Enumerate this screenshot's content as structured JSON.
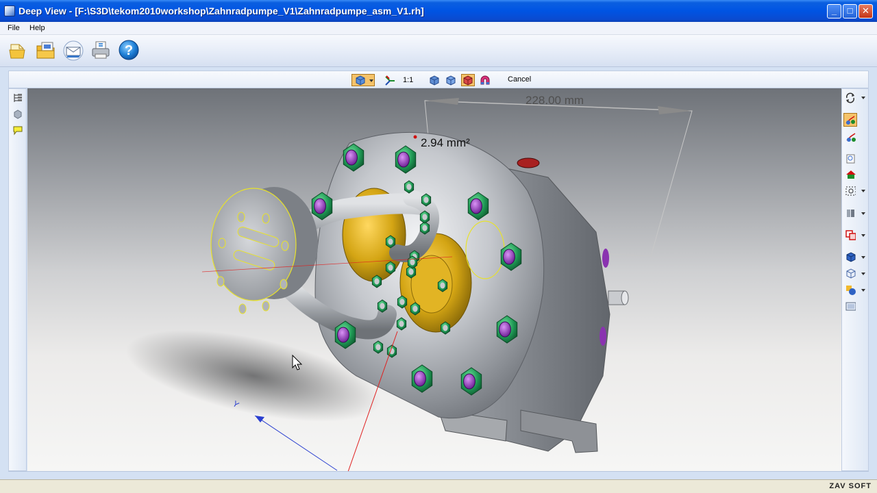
{
  "window": {
    "title": "Deep View - [F:\\S3D\\tekom2010workshop\\Zahnradpumpe_V1\\Zahnradpumpe_asm_V1.rh]",
    "min_glyph": "_",
    "max_glyph": "□",
    "close_glyph": "✕"
  },
  "menu": {
    "items": [
      {
        "label": "File"
      },
      {
        "label": "Help"
      }
    ]
  },
  "toolbar": {
    "buttons": [
      {
        "icon": "open-file-icon"
      },
      {
        "icon": "open-folder-icon"
      },
      {
        "icon": "email-icon"
      },
      {
        "icon": "print-icon"
      },
      {
        "icon": "help-icon",
        "glyph": "?"
      }
    ]
  },
  "view_toolbar": {
    "one_to_one": "1:1",
    "cancel": "Cancel"
  },
  "viewport": {
    "measure_length": "228.00 mm",
    "measure_area": "2.94 mm²",
    "axis_y_label": "Y"
  },
  "statusbar": {
    "watermark": "ZAV SOFT"
  },
  "colors": {
    "title_blue": "#0054e3",
    "bolt_green": "#1f9a55",
    "bolt_purple": "#8a33b0",
    "gear_cover_gold": "#d4a514",
    "highlight_yellow": "#e8e22a",
    "axis_red": "#e02020",
    "axis_blue": "#2a3fd0"
  }
}
